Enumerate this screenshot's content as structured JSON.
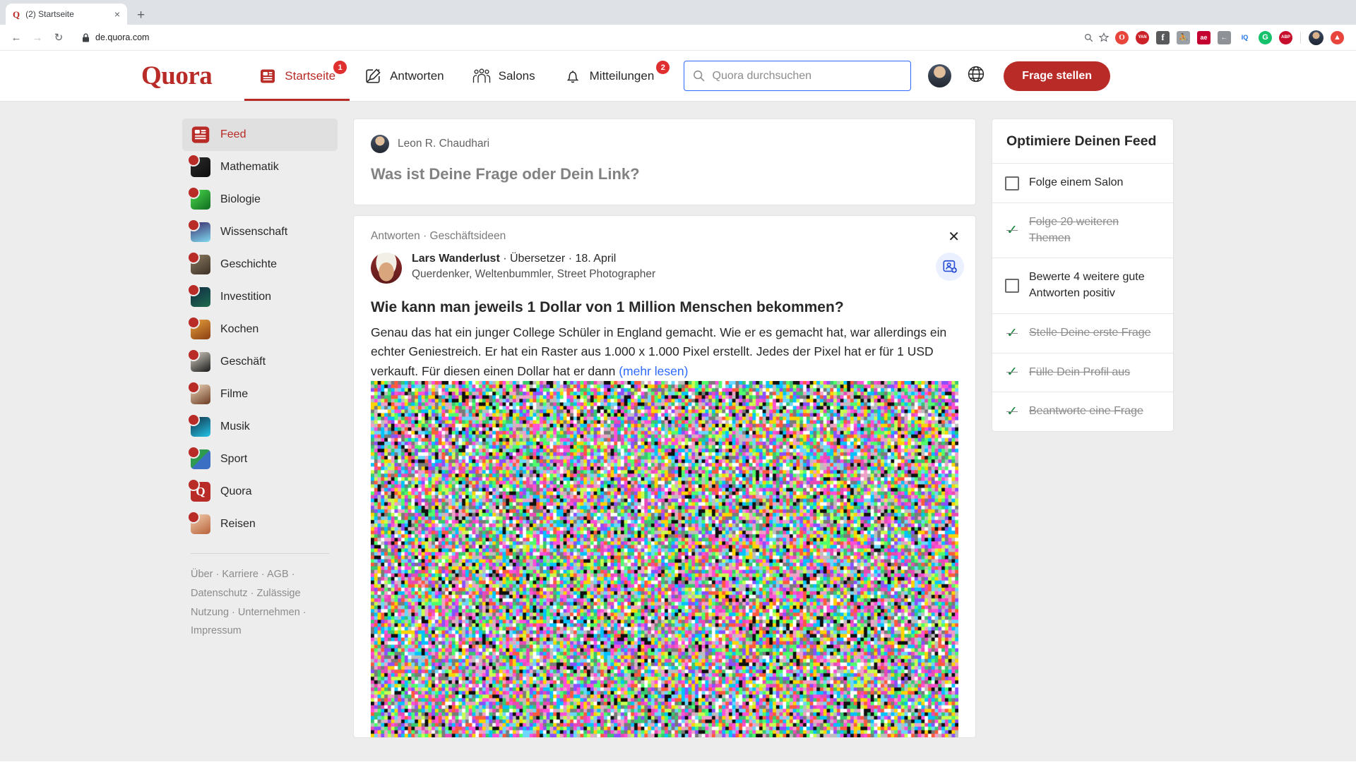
{
  "browser": {
    "tab": {
      "favicon": "quora-favicon",
      "title": "(2) Startseite",
      "close": "×"
    },
    "new_tab": "+",
    "nav": {
      "back": "←",
      "forward": "→",
      "reload": "↻"
    },
    "url": "de.quora.com",
    "lock": "🔒",
    "omni_actions": [
      {
        "name": "zoom-icon",
        "glyph": "⊕"
      },
      {
        "name": "bookmark-star-icon",
        "glyph": "☆"
      }
    ],
    "extensions": [
      {
        "name": "opera-extension-icon",
        "label": "O",
        "color": "#e8453c"
      },
      {
        "name": "yandex-extension-icon",
        "label": "YAN",
        "color": "#cc2128"
      },
      {
        "name": "facebook-extension-icon",
        "label": "f",
        "color": "#595a5c"
      },
      {
        "name": "runner-extension-icon",
        "label": "☿",
        "color": "#9aa0a6"
      },
      {
        "name": "ae-extension-icon",
        "label": "ae",
        "color": "#c3002f"
      },
      {
        "name": "pocket-extension-icon",
        "label": "←",
        "color": "#8e9296"
      },
      {
        "name": "iq-extension-icon",
        "label": "IQ",
        "color": "#1a73e8"
      },
      {
        "name": "grammarly-extension-icon",
        "label": "G",
        "color": "#15c26b"
      },
      {
        "name": "adblock-extension-icon",
        "label": "ABP",
        "color": "#c70d2c"
      }
    ],
    "profile_avatar": "browser-profile-avatar",
    "menu_icon": "opera-menu-icon"
  },
  "header": {
    "logo": "Quora",
    "nav": [
      {
        "label": "Startseite",
        "icon": "feed-icon",
        "badge": "1",
        "active": true
      },
      {
        "label": "Antworten",
        "icon": "pencil-answer-icon",
        "badge": "",
        "active": false
      },
      {
        "label": "Salons",
        "icon": "people-group-icon",
        "badge": "",
        "active": false
      },
      {
        "label": "Mitteilungen",
        "icon": "bell-icon",
        "badge": "2",
        "active": false
      }
    ],
    "search": {
      "placeholder": "Quora durchsuchen",
      "value": "",
      "icon": "search-icon"
    },
    "avatar": "user-avatar",
    "language_icon": "globe-icon",
    "ask_button": "Frage stellen",
    "accent_color": "#b92b27"
  },
  "sidebar": {
    "items": [
      {
        "label": "Feed",
        "icon": "feed-icon",
        "active": true
      },
      {
        "label": "Mathematik",
        "icon": "topic-thumb-mathematik",
        "active": false
      },
      {
        "label": "Biologie",
        "icon": "topic-thumb-biologie",
        "active": false
      },
      {
        "label": "Wissenschaft",
        "icon": "topic-thumb-wissenschaft",
        "active": false
      },
      {
        "label": "Geschichte",
        "icon": "topic-thumb-geschichte",
        "active": false
      },
      {
        "label": "Investition",
        "icon": "topic-thumb-investition",
        "active": false
      },
      {
        "label": "Kochen",
        "icon": "topic-thumb-kochen",
        "active": false
      },
      {
        "label": "Geschäft",
        "icon": "topic-thumb-geschaeft",
        "active": false
      },
      {
        "label": "Filme",
        "icon": "topic-thumb-filme",
        "active": false
      },
      {
        "label": "Musik",
        "icon": "topic-thumb-musik",
        "active": false
      },
      {
        "label": "Sport",
        "icon": "topic-thumb-sport",
        "active": false
      },
      {
        "label": "Quora",
        "icon": "topic-thumb-quora",
        "active": false
      },
      {
        "label": "Reisen",
        "icon": "topic-thumb-reisen",
        "active": false
      }
    ],
    "footer_links": [
      "Über",
      "Karriere",
      "AGB",
      "Datenschutz",
      "Zulässige Nutzung",
      "Unternehmen",
      "Impressum"
    ],
    "footer_separator": " · "
  },
  "compose": {
    "author": "Leon R. Chaudhari",
    "prompt": "Was ist Deine Frage oder Dein Link?"
  },
  "post": {
    "meta": "Antworten · Geschäftsideen",
    "close_glyph": "✕",
    "follow_icon": "add-person-card-icon",
    "author_name": "Lars Wanderlust",
    "author_role": "Übersetzer",
    "author_date": "18. April",
    "author_sub": "Querdenker, Weltenbummler, Street Photographer",
    "title": "Wie kann man jeweils 1 Dollar von 1 Million Menschen bekommen?",
    "body": "Genau das hat ein junger College Schüler in England gemacht. Wie er es gemacht hat, war allerdings ein echter Geniestreich. Er hat ein Raster aus 1.000 x 1.000 Pixel erstellt. Jedes der Pixel hat er für 1 USD verkauft. Für diesen einen Dollar hat er dann",
    "more_link": "(mehr lesen)",
    "image_alt": "pixel-noise-image"
  },
  "right_panel": {
    "title": "Optimiere Deinen Feed",
    "items": [
      {
        "label": "Folge einem Salon",
        "done": false
      },
      {
        "label": "Folge 20 weiteren Themen",
        "done": true
      },
      {
        "label": "Bewerte 4 weitere gute Antworten positiv",
        "done": false
      },
      {
        "label": "Stelle Deine erste Frage",
        "done": true
      },
      {
        "label": "Fülle Dein Profil aus",
        "done": true
      },
      {
        "label": "Beantworte eine Frage",
        "done": true
      }
    ],
    "check_glyph": "✓",
    "check_color": "#17803d"
  }
}
